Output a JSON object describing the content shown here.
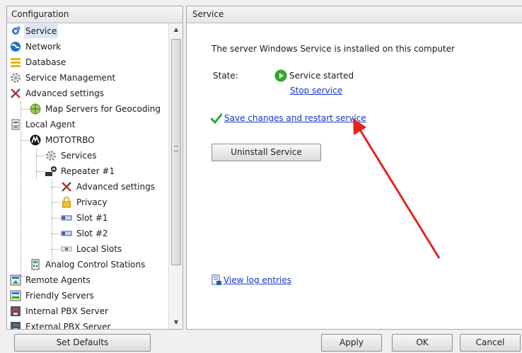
{
  "left_panel": {
    "header": "Configuration",
    "tree": [
      {
        "label": "Service",
        "icon": "gear-blue-icon",
        "selected": true
      },
      {
        "label": "Network",
        "icon": "globe-icon"
      },
      {
        "label": "Database",
        "icon": "database-icon"
      },
      {
        "label": "Service Management",
        "icon": "gear-grey-icon"
      },
      {
        "label": "Advanced settings",
        "icon": "tools-icon"
      },
      {
        "label": "Map Servers for Geocoding",
        "icon": "map-globe-icon"
      },
      {
        "label": "Local Agent",
        "icon": "local-agent-icon"
      },
      {
        "label": "MOTOTRBO",
        "icon": "motorola-logo-icon"
      },
      {
        "label": "Services",
        "icon": "gear-grey-icon"
      },
      {
        "label": "Repeater #1",
        "icon": "repeater-icon"
      },
      {
        "label": "Advanced settings",
        "icon": "tools-icon"
      },
      {
        "label": "Privacy",
        "icon": "lock-icon"
      },
      {
        "label": "Slot #1",
        "icon": "slot-icon"
      },
      {
        "label": "Slot #2",
        "icon": "slot-icon"
      },
      {
        "label": "Local Slots",
        "icon": "local-slots-icon"
      },
      {
        "label": "Analog Control Stations",
        "icon": "analog-station-icon"
      },
      {
        "label": "Remote Agents",
        "icon": "remote-agent-icon"
      },
      {
        "label": "Friendly Servers",
        "icon": "server-icon"
      },
      {
        "label": "Internal PBX Server",
        "icon": "pbx-icon"
      },
      {
        "label": "External PBX Server",
        "icon": "pbx-icon"
      }
    ],
    "set_defaults_label": "Set Defaults"
  },
  "right_panel": {
    "header": "Service",
    "installed_text": "The server Windows Service is installed on this computer",
    "state_label": "State:",
    "state_value": "Service started",
    "stop_service_link": "Stop service",
    "save_restart_link": "Save changes and restart service",
    "uninstall_label": "Uninstall Service",
    "view_log_link": "View log entries"
  },
  "footer": {
    "apply_label": "Apply",
    "ok_label": "OK",
    "cancel_label": "Cancel"
  },
  "colors": {
    "link": "#1a35c8",
    "annotation_arrow": "#e8231c",
    "state_started": "#2ea82e"
  }
}
